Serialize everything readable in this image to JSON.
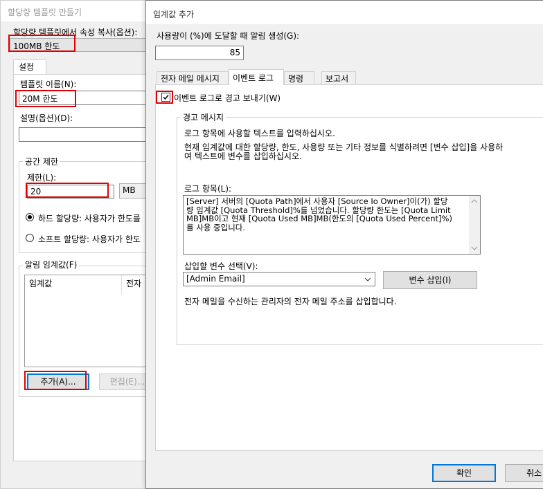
{
  "back_window": {
    "title": "할당량 템플릿 만들기",
    "copy_label": "할당량 템플릿에서 속성 복사(옵션):",
    "copy_value": "100MB 한도",
    "tab_settings": "설정",
    "template_name_label": "템플릿 이름(N):",
    "template_name_value": "20M 한도",
    "description_label": "설명(옵션)(D):",
    "description_value": "",
    "space_limit_label": "공간 제한",
    "limit_label": "제한(L):",
    "limit_value": "20",
    "limit_unit": "MB",
    "hard_quota": "하드 할당량: 사용자가 한도를",
    "soft_quota": "소프트 할당량: 사용자가 한도",
    "thresholds_label": "알림 임계값(F)",
    "col_threshold": "임계값",
    "col_email": "전자",
    "add_button": "추가(A)...",
    "edit_button": "편집(E)..."
  },
  "front_window": {
    "title": "임계값 추가",
    "usage_label": "사용량이 (%)에 도달할 때 알림 생성(G):",
    "usage_value": "85",
    "tabs": [
      {
        "label": "전자 메일 메시지"
      },
      {
        "label": "이벤트 로그"
      },
      {
        "label": "명령"
      },
      {
        "label": "보고서"
      }
    ],
    "event_log_checkbox": "이벤트 로그로 경고 보내기(W)",
    "warning_message_group": "경고 메시지",
    "instruction_1": "로그 항목에 사용할 텍스트를 입력하십시오.",
    "instruction_2_line1": "현재 임계값에 대한 할당량, 한도, 사용량 또는 기타 정보를 식별하려면 [변수 삽입]을 사용하",
    "instruction_2_line2": "여 텍스트에 변수를 삽입하십시오.",
    "log_entry_label": "로그 항목(L):",
    "log_entry_line1": "[Server] 서버의 [Quota Path]에서 사용자 [Source Io Owner]이(가) 할당",
    "log_entry_line2": "량 임계값 [Quota Threshold]%를 넘었습니다. 할당량 한도는 [Quota Limit",
    "log_entry_line3": "MB]MB이고 현재 [Quota Used MB]MB(한도의 [Quota Used Percent]%)",
    "log_entry_line4": "를 사용 중입니다.",
    "insert_var_label": "삽입할 변수 선택(V):",
    "insert_var_value": "[Admin Email]",
    "insert_var_button": "변수 삽입(I)",
    "var_description": "전자 메일을 수신하는 관리자의 전자 메일 주소를 삽입합니다.",
    "ok_button": "확인",
    "cancel_button": "취소"
  }
}
